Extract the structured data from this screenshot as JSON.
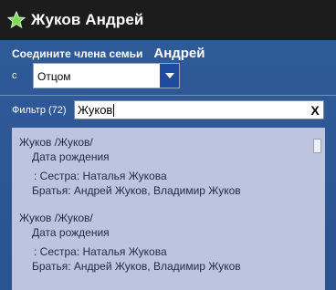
{
  "window": {
    "title": "Жуков Андрей"
  },
  "connect": {
    "label": "Соедините члена семьи",
    "person": "Андрей"
  },
  "relation": {
    "with_label": "с",
    "selected": "Отцом"
  },
  "filter": {
    "label": "Фильтр (72)",
    "value": "Жуков",
    "clear": "X"
  },
  "results": [
    {
      "name": "Жуков /Жуков/",
      "birth": "Дата рождения",
      "sister": ": Сестра: Наталья Жукова",
      "brothers": "Братья: Андрей Жуков, Владимир Жуков"
    },
    {
      "name": "Жуков /Жуков/",
      "birth": "Дата рождения",
      "sister": ": Сестра: Наталья Жукова",
      "brothers": "Братья: Андрей Жуков, Владимир Жуков"
    }
  ],
  "colors": {
    "titlebar": "#1c1c1c",
    "panel": "#2b5591",
    "results_bg": "#bdc4e0",
    "star": "#7ed957"
  },
  "icons": {
    "title": "star-icon",
    "dropdown": "chevron-down-icon",
    "clear": "close-icon"
  }
}
